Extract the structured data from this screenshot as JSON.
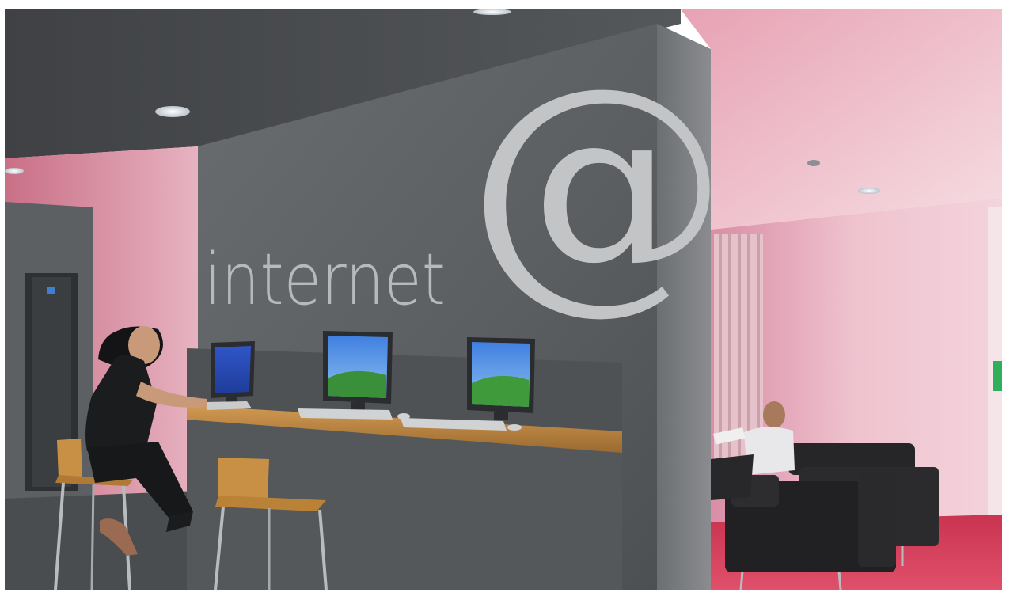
{
  "photo": {
    "signage": {
      "word": "internet",
      "symbol": "@"
    },
    "screens": [
      {
        "name": "monitor-left",
        "wallpaper": "blue-desktop"
      },
      {
        "name": "monitor-middle",
        "wallpaper": "green-hills-desktop"
      },
      {
        "name": "monitor-right",
        "wallpaper": "green-hills-desktop"
      }
    ],
    "colors": {
      "wall_grey": "#5f6265",
      "ceiling_grey": "#4c4e51",
      "counter_wood": "#b8823f",
      "right_room_pink": "#e8b6c4",
      "carpet_red": "#d63a55",
      "sofa_black": "#232326"
    }
  }
}
